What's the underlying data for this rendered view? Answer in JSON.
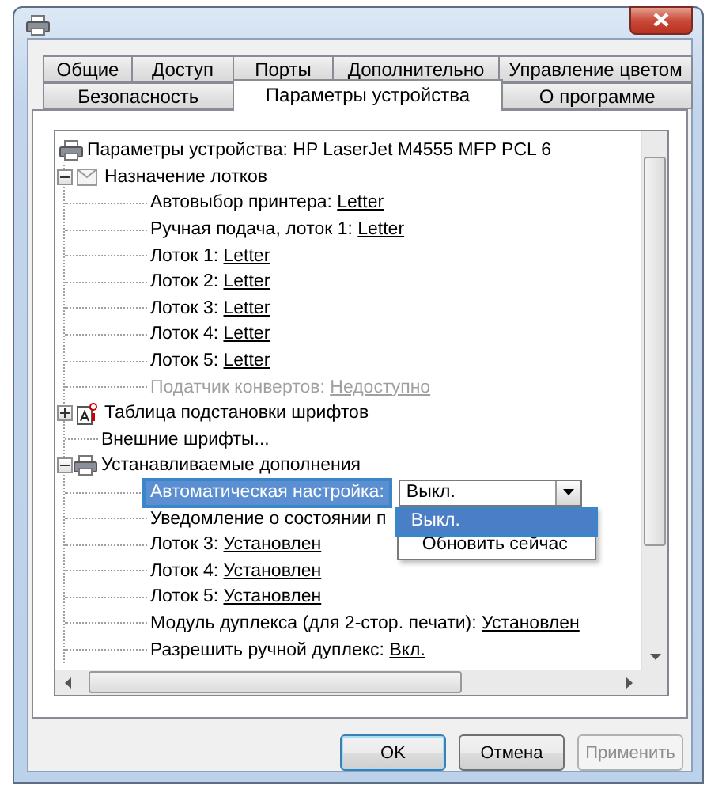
{
  "tab_rows": [
    {
      "tabs": [
        {
          "label": "Общие",
          "selected": false
        },
        {
          "label": "Доступ",
          "selected": false
        },
        {
          "label": "Порты",
          "selected": false
        },
        {
          "label": "Дополнительно",
          "selected": false
        },
        {
          "label": "Управление цветом",
          "selected": false
        }
      ]
    },
    {
      "tabs": [
        {
          "label": "Безопасность",
          "selected": false
        },
        {
          "label": "Параметры устройства",
          "selected": true
        },
        {
          "label": "О программе",
          "selected": false
        }
      ]
    }
  ],
  "tree": {
    "label": "Параметры устройства: HP LaserJet M4555 MFP PCL 6",
    "children": [
      {
        "label": "Назначение лотков",
        "expanded": true,
        "children": [
          {
            "kind": "setting",
            "label": "Автовыбор принтера:",
            "value": "Letter",
            "disabled": false
          },
          {
            "kind": "setting",
            "label": "Ручная подача, лоток 1:",
            "value": "Letter",
            "disabled": false
          },
          {
            "kind": "setting",
            "label": "Лоток 1:",
            "value": "Letter",
            "disabled": false
          },
          {
            "kind": "setting",
            "label": "Лоток 2:",
            "value": "Letter",
            "disabled": false
          },
          {
            "kind": "setting",
            "label": "Лоток 3:",
            "value": "Letter",
            "disabled": false
          },
          {
            "kind": "setting",
            "label": "Лоток 4:",
            "value": "Letter",
            "disabled": false
          },
          {
            "kind": "setting",
            "label": "Лоток 5:",
            "value": "Letter",
            "disabled": false
          },
          {
            "kind": "setting",
            "label": "Податчик конвертов:",
            "value": "Недоступно",
            "disabled": true
          }
        ]
      },
      {
        "label": "Таблица подстановки шрифтов",
        "expanded": false
      },
      {
        "label": "Внешние шрифты..."
      },
      {
        "label": "Устанавливаемые дополнения",
        "expanded": true,
        "children": [
          {
            "kind": "combo",
            "label": "Автоматическая настройка:",
            "selected": true,
            "value": "Выкл.",
            "open": true,
            "options": [
              {
                "label": "Выкл.",
                "selected": true
              },
              {
                "label": "Обновить сейчас",
                "selected": false
              }
            ]
          },
          {
            "kind": "setting",
            "label": "Уведомление о состоянии п",
            "disabled": false
          },
          {
            "kind": "setting",
            "label": "Лоток 3:",
            "value": "Установлен",
            "disabled": false
          },
          {
            "kind": "setting",
            "label": "Лоток 4:",
            "value": "Установлен",
            "disabled": false
          },
          {
            "kind": "setting",
            "label": "Лоток 5:",
            "value": "Установлен",
            "disabled": false
          },
          {
            "kind": "setting",
            "label": "Модуль дуплекса (для 2-стор. печати):",
            "value": "Установлен",
            "disabled": false
          },
          {
            "kind": "setting",
            "label": "Разрешить ручной дуплекс:",
            "value": "Вкл.",
            "disabled": false
          }
        ]
      }
    ]
  },
  "buttons": [
    {
      "label": "OK",
      "default": true,
      "disabled": false
    },
    {
      "label": "Отмена",
      "default": false,
      "disabled": false
    },
    {
      "label": "Применить",
      "default": false,
      "disabled": true
    }
  ]
}
